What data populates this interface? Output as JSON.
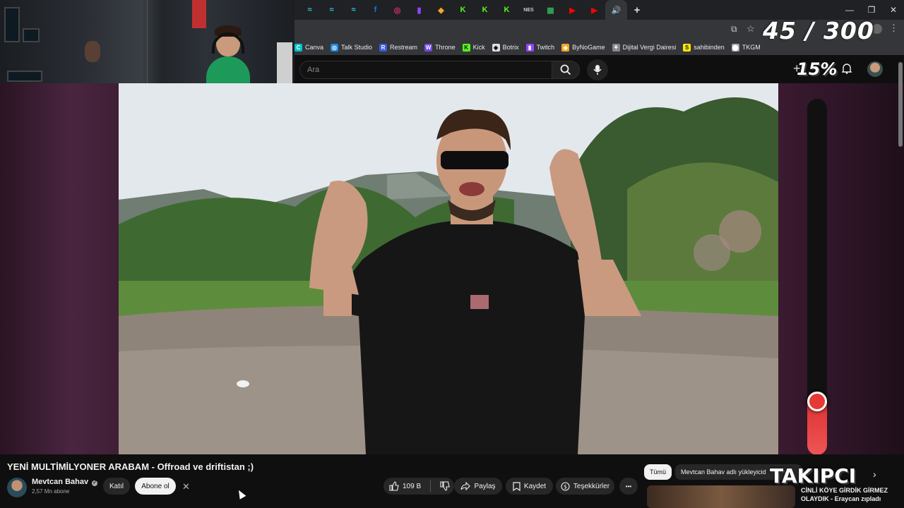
{
  "browser": {
    "tabs": [
      {
        "icon": "t-icon",
        "glyph": "≈",
        "color": "#2ec4d6"
      },
      {
        "icon": "t-icon",
        "glyph": "≈",
        "color": "#2ec4d6"
      },
      {
        "icon": "t-icon",
        "glyph": "≈",
        "color": "#2ec4d6"
      },
      {
        "icon": "facebook-icon",
        "glyph": "f",
        "color": "#1877f2"
      },
      {
        "icon": "instagram-icon",
        "glyph": "◎",
        "color": "#e1306c"
      },
      {
        "icon": "twitch-icon",
        "glyph": "▮",
        "color": "#9146ff"
      },
      {
        "icon": "bynogame-icon",
        "glyph": "◆",
        "color": "#f5a623"
      },
      {
        "icon": "kick-icon",
        "glyph": "K",
        "color": "#53fc18"
      },
      {
        "icon": "kick-icon",
        "glyph": "K",
        "color": "#53fc18"
      },
      {
        "icon": "kick-icon",
        "glyph": "K",
        "color": "#53fc18"
      },
      {
        "icon": "nes-icon",
        "glyph": "NES",
        "color": "#cccccc"
      },
      {
        "icon": "sheets-icon",
        "glyph": "▦",
        "color": "#34a853"
      },
      {
        "icon": "youtube-icon",
        "glyph": "▶",
        "color": "#ff0000"
      },
      {
        "icon": "youtube-icon",
        "glyph": "▶",
        "color": "#ff0000"
      },
      {
        "icon": "speaker-icon",
        "glyph": "🔊",
        "color": "#dddddd",
        "active": true
      }
    ],
    "new_tab": "+",
    "bookmarks": [
      {
        "label": "Canva",
        "glyph": "C",
        "color": "#00c4cc"
      },
      {
        "label": "Talk Studio",
        "glyph": "◎",
        "color": "#1e88e5"
      },
      {
        "label": "Restream",
        "glyph": "R",
        "color": "#3b5bdb"
      },
      {
        "label": "Throne",
        "glyph": "W",
        "color": "#7048e8"
      },
      {
        "label": "Kick",
        "glyph": "K",
        "color": "#53fc18"
      },
      {
        "label": "Botrix",
        "glyph": "◆",
        "color": "#dddddd"
      },
      {
        "label": "Twitch",
        "glyph": "▮",
        "color": "#9146ff"
      },
      {
        "label": "ByNoGame",
        "glyph": "◆",
        "color": "#f5a623"
      },
      {
        "label": "Dijital Vergi Dairesi",
        "glyph": "⚘",
        "color": "#888888"
      },
      {
        "label": "sahibinden",
        "glyph": "S",
        "color": "#ffe800"
      },
      {
        "label": "TKGM",
        "glyph": "⬤",
        "color": "#aaaaaa"
      }
    ]
  },
  "overlay": {
    "goal_counter": "45 / 300",
    "goal_percent": "15%",
    "meter_level": 0.15,
    "follower_label": "TAKIPCI"
  },
  "youtube": {
    "search_placeholder": "Ara",
    "video_title": "YENİ MULTİMİLYONER ARABAM - Offroad ve driftistan ;)",
    "channel_name": "Mevtcan Bahav",
    "subscribers": "2,57 Mn abone",
    "join_label": "Katıl",
    "subscribe_label": "Abone ol",
    "like_count": "109 B",
    "share_label": "Paylaş",
    "save_label": "Kaydet",
    "thanks_label": "Teşekkürler",
    "more_label": "•••"
  },
  "side_panel": {
    "chip_all": "Tümü",
    "chip_uploader": "Mevtcan Bahav adlı yükleyicid",
    "rec_title_line1": "CİNLİ KÖYE GİRDİK GİRMEZ",
    "rec_title_line2": "OLAYDIK - Eraycan zıpladı"
  }
}
